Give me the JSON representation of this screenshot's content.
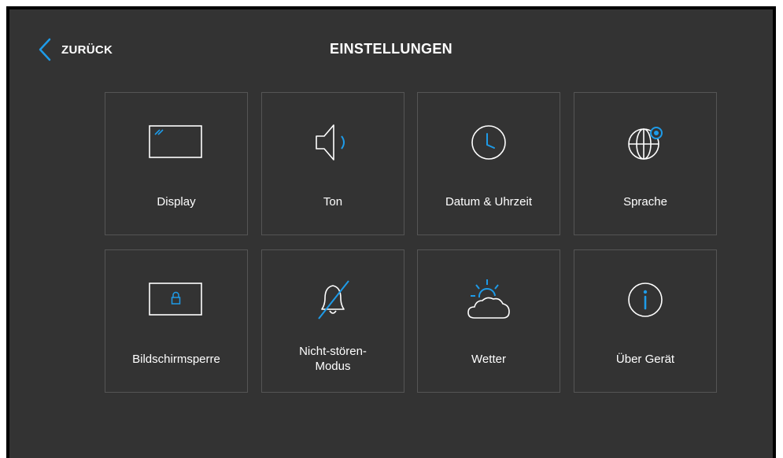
{
  "header": {
    "back_label": "ZURÜCK",
    "title": "EINSTELLUNGEN"
  },
  "tiles": [
    {
      "label": "Display",
      "icon": "display-icon"
    },
    {
      "label": "Ton",
      "icon": "speaker-icon"
    },
    {
      "label": "Datum & Uhrzeit",
      "icon": "clock-icon"
    },
    {
      "label": "Sprache",
      "icon": "globe-icon"
    },
    {
      "label": "Bildschirmsperre",
      "icon": "screen-lock-icon"
    },
    {
      "label": "Nicht-stören-\nModus",
      "icon": "bell-off-icon"
    },
    {
      "label": "Wetter",
      "icon": "weather-icon"
    },
    {
      "label": "Über Gerät",
      "icon": "info-icon"
    }
  ],
  "colors": {
    "background": "#333333",
    "accent": "#1e9be8",
    "tile_border": "#555555",
    "text": "#ffffff"
  }
}
